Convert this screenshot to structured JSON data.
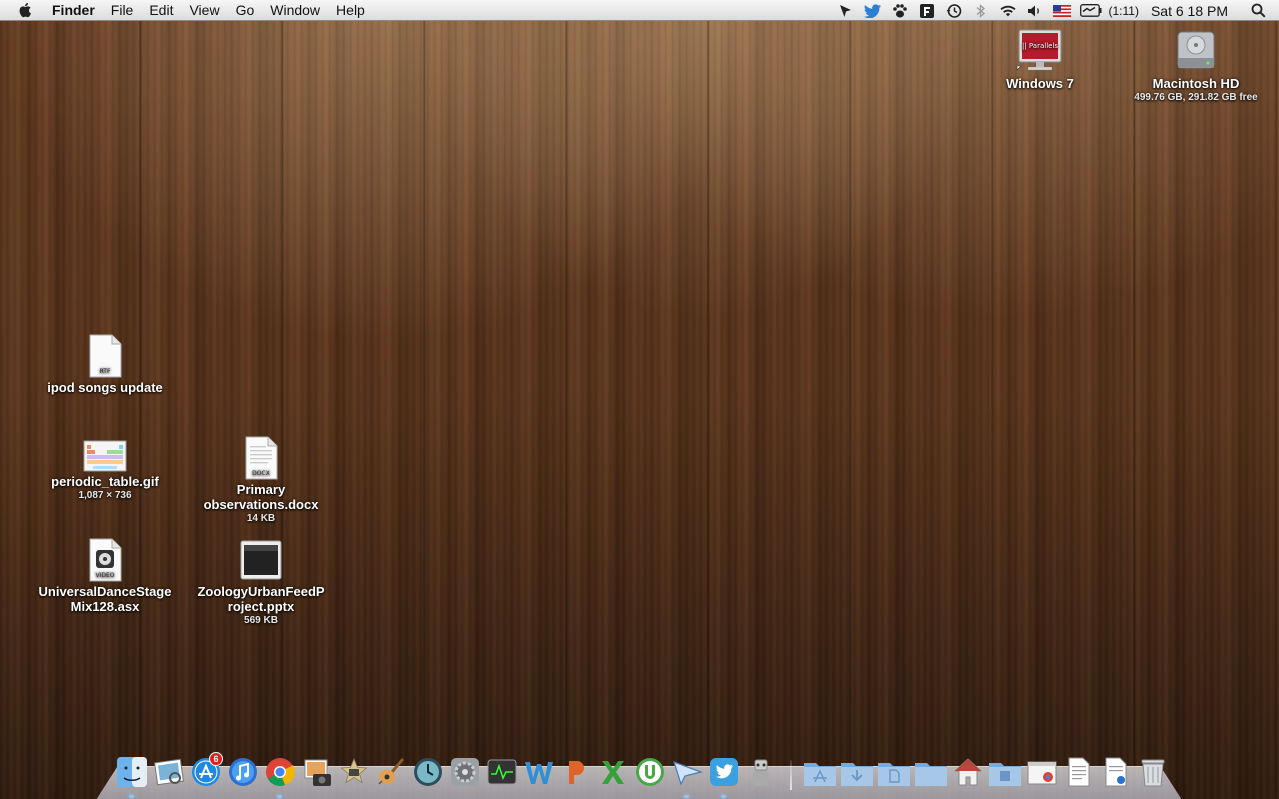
{
  "menubar": {
    "app_name": "Finder",
    "menus": [
      "File",
      "Edit",
      "View",
      "Go",
      "Window",
      "Help"
    ],
    "status_icons": [
      "cursor-icon",
      "twitter-bird-icon",
      "paw-icon",
      "box-icon",
      "time-machine-icon",
      "bluetooth-icon",
      "wifi-icon",
      "volume-icon",
      "flag-us-icon",
      "battery-icon"
    ],
    "battery_time": "(1:11)",
    "clock": "Sat 6 18 PM"
  },
  "desktop": {
    "icons": [
      {
        "name": "Windows 7",
        "sub": "",
        "kind": "parallels"
      },
      {
        "name": "Macintosh HD",
        "sub": "499.76 GB, 291.82 GB free",
        "kind": "harddisk"
      },
      {
        "name": "ipod songs update",
        "sub": "",
        "kind": "rtf"
      },
      {
        "name": "periodic_table.gif",
        "sub": "1,087 × 736",
        "kind": "gif"
      },
      {
        "name": "Primary observations.docx",
        "sub": "14 KB",
        "kind": "docx"
      },
      {
        "name": "UniversalDanceStageMix128.asx",
        "sub": "",
        "kind": "video"
      },
      {
        "name": "ZoologyUrbanFeedProject.pptx",
        "sub": "569 KB",
        "kind": "pptx"
      }
    ],
    "labels": {
      "parallels_logo": "|| Parallels",
      "rtf_badge": "RTF",
      "docx_badge": "DOCX",
      "video_badge": "VIDEO"
    }
  },
  "dock": {
    "apps": [
      "finder-icon",
      "preview-icon",
      "app-store-icon",
      "itunes-icon",
      "chrome-icon",
      "iphoto-icon",
      "imovie-icon",
      "garageband-icon",
      "time-machine-icon",
      "system-preferences-icon",
      "activity-monitor-icon",
      "word-icon",
      "powerpoint-icon",
      "excel-icon",
      "utorrent-icon",
      "send-icon",
      "twitter-icon",
      "automator-icon"
    ],
    "app_store_badge": "6",
    "stacks": [
      "applications-stack-icon",
      "downloads-stack-icon",
      "documents-stack-icon",
      "folder-stack-icon",
      "home-folder-icon",
      "windows-folder-icon",
      "web-document-icon",
      "text-document-icon",
      "stack-document-icon",
      "trash-icon"
    ]
  }
}
